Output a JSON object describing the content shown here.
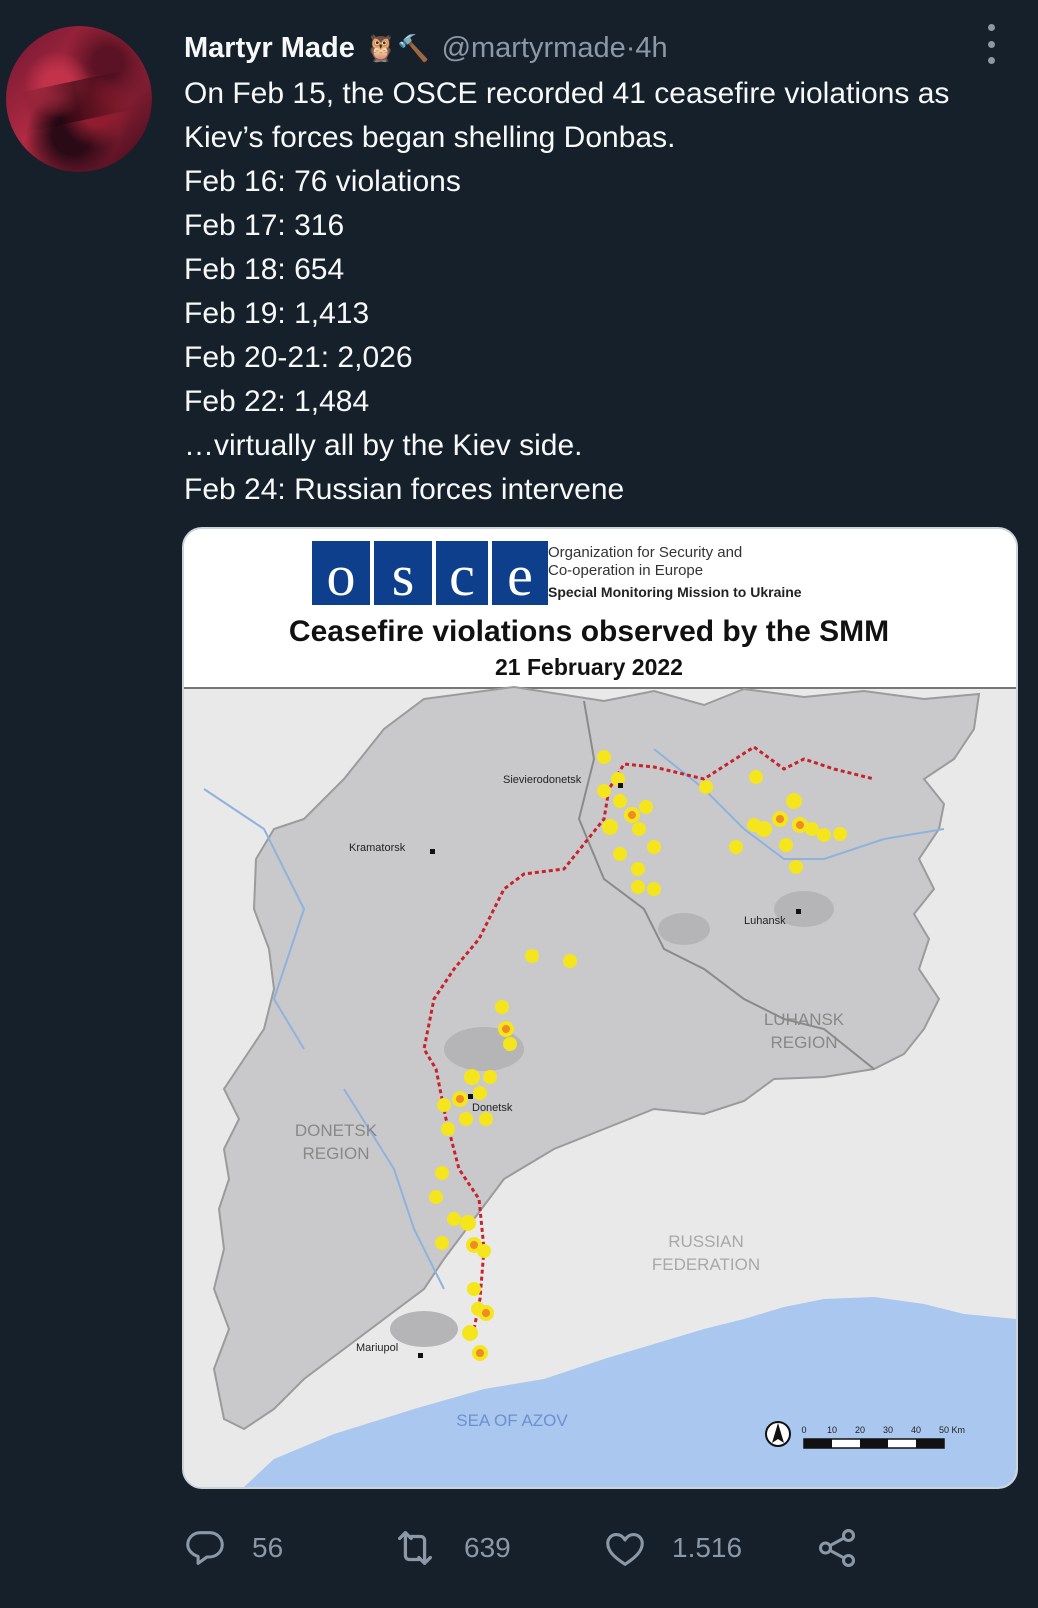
{
  "tweet": {
    "author_name": "Martyr Made",
    "author_emoji": "🦉🔨",
    "handle": "@martyrmade",
    "separator": " · ",
    "time": "4h",
    "lines": [
      "On Feb 15, the OSCE recorded 41 ceasefire violations as",
      "Kiev’s forces began shelling Donbas.",
      "Feb 16: 76 violations",
      "Feb 17: 316",
      "Feb 18: 654",
      "Feb 19: 1,413",
      "Feb 20-21: 2,026",
      "Feb 22: 1,484",
      "…virtually all by the Kiev side.",
      "Feb 24: Russian forces intervene"
    ]
  },
  "media": {
    "logo_letters": [
      "o",
      "s",
      "c",
      "e"
    ],
    "org_line1": "Organization for Security and",
    "org_line2": "Co-operation in Europe",
    "org_line3": "Special Monitoring Mission to Ukraine",
    "title": "Ceasefire violations observed by the SMM",
    "date": "21 February 2022",
    "map_labels": {
      "sievierodonetsk": "Sievierodonetsk",
      "kramatorsk": "Kramatorsk",
      "luhansk": "Luhansk",
      "donetsk": "Donetsk",
      "mariupol": "Mariupol",
      "luhansk_region_1": "LUHANSK",
      "luhansk_region_2": "REGION",
      "donetsk_region_1": "DONETSK",
      "donetsk_region_2": "REGION",
      "russia_1": "RUSSIAN",
      "russia_2": "FEDERATION",
      "sea": "SEA OF AZOV"
    },
    "scale_labels": [
      "0",
      "10",
      "20",
      "30",
      "40",
      "50 Km"
    ],
    "colors": {
      "logo_blue": "#0e3f8c",
      "marker_yellow": "#f5e51c",
      "marker_orange": "#f08a24",
      "contact_line": "#c8232c",
      "sea": "#a9c7ef",
      "land": "#cfcfcf"
    }
  },
  "actions": {
    "reply_count": "56",
    "retweet_count": "639",
    "like_count": "1.516"
  },
  "icons": [
    "reply-icon",
    "retweet-icon",
    "like-icon",
    "share-icon",
    "more-icon"
  ]
}
